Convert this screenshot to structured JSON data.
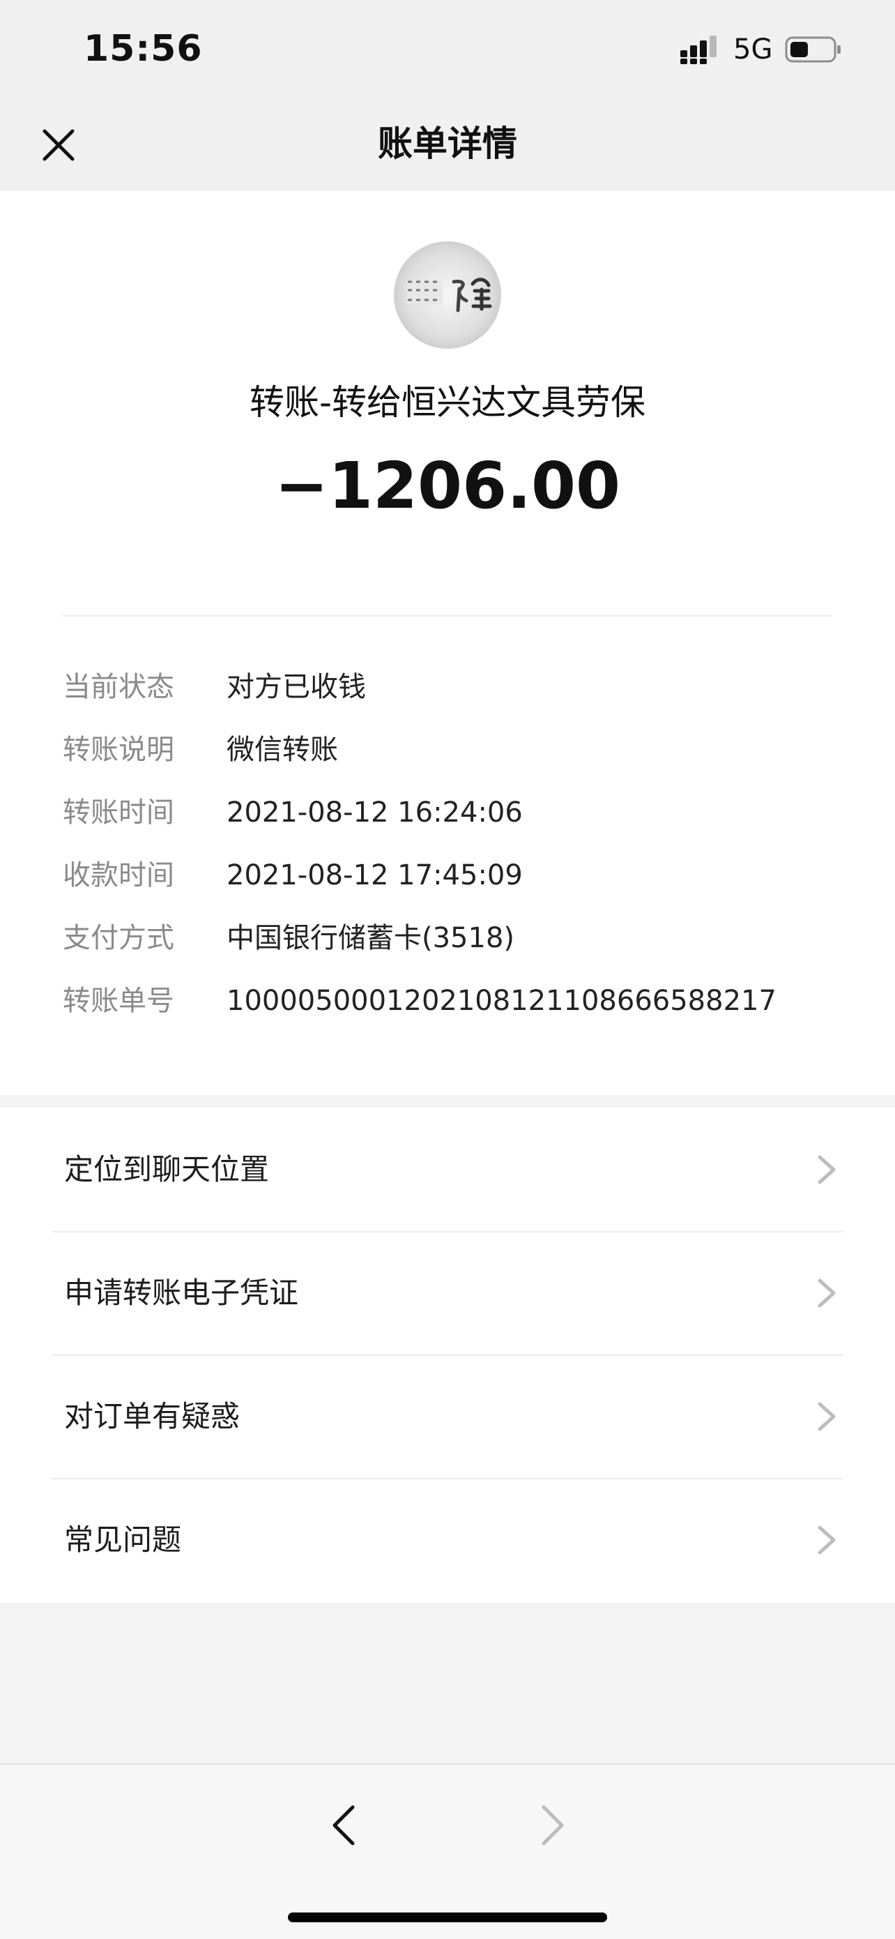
{
  "status_bar": {
    "time": "15:56",
    "network": "5G",
    "icons": [
      "signal-icon",
      "battery-icon"
    ]
  },
  "header": {
    "title": "账单详情",
    "close_icon": "close-icon"
  },
  "transfer": {
    "avatar_icon": "merchant-avatar",
    "title": "转账-转给恒兴达文具劳保",
    "amount": "−1206.00",
    "details": [
      {
        "label": "当前状态",
        "value": "对方已收钱"
      },
      {
        "label": "转账说明",
        "value": "微信转账"
      },
      {
        "label": "转账时间",
        "value": "2021-08-12 16:24:06"
      },
      {
        "label": "收款时间",
        "value": "2021-08-12 17:45:09"
      },
      {
        "label": "支付方式",
        "value": "中国银行储蓄卡(3518)"
      },
      {
        "label": "转账单号",
        "value": "1000050001202108121108666588217"
      }
    ]
  },
  "actions": [
    {
      "label": "定位到聊天位置"
    },
    {
      "label": "申请转账电子凭证"
    },
    {
      "label": "对订单有疑惑"
    },
    {
      "label": "常见问题"
    }
  ],
  "bottom_bar": {
    "icons": [
      "back-arrow-icon",
      "forward-arrow-icon"
    ]
  },
  "colors": {
    "background": "#f3f3f3",
    "card": "#ffffff",
    "muted_text": "#8a8a8a",
    "primary_text": "#111111",
    "chevron": "#bdbdbd"
  }
}
